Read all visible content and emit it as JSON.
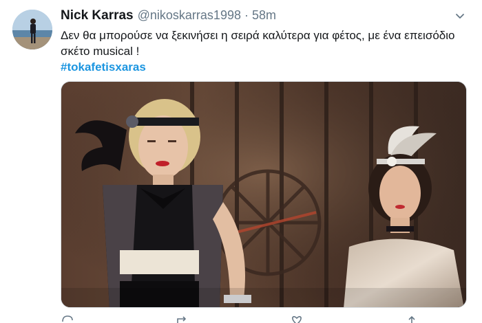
{
  "tweet": {
    "author_name": "Nick Karras",
    "handle": "@nikoskarras1998",
    "separator": "·",
    "time": "58m",
    "text": "Δεν θα μπορούσε να ξεκινήσει η σειρά καλύτερα για φέτος, με ένα επεισόδιο σκέτο musical !",
    "hashtag": "#tokafetisxaras"
  },
  "icons": {
    "caret": "chevron-down-icon",
    "reply": "reply-icon",
    "retweet": "retweet-icon",
    "like": "heart-icon",
    "share": "share-icon"
  },
  "colors": {
    "name": "#14171a",
    "meta": "#657786",
    "hashtag": "#1b95e0",
    "divider": "#d8dee3"
  }
}
